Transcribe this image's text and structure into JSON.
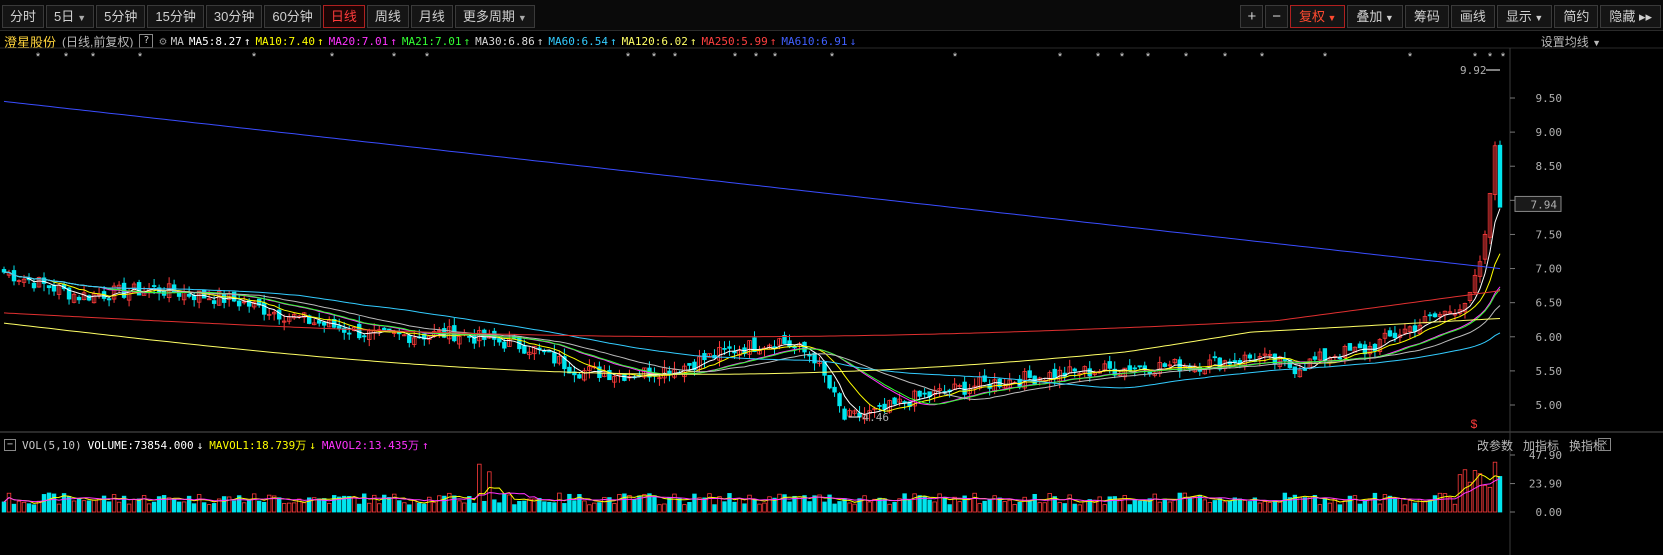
{
  "toolbar": {
    "tabs": [
      {
        "label": "分时",
        "dd": false,
        "active": false
      },
      {
        "label": "5日",
        "dd": true,
        "active": false
      },
      {
        "label": "5分钟",
        "dd": false,
        "active": false
      },
      {
        "label": "15分钟",
        "dd": false,
        "active": false
      },
      {
        "label": "30分钟",
        "dd": false,
        "active": false
      },
      {
        "label": "60分钟",
        "dd": false,
        "active": false
      },
      {
        "label": "日线",
        "dd": false,
        "active": true
      },
      {
        "label": "周线",
        "dd": false,
        "active": false
      },
      {
        "label": "月线",
        "dd": false,
        "active": false
      },
      {
        "label": "更多周期",
        "dd": true,
        "active": false
      }
    ],
    "right": [
      {
        "label": "+",
        "small": true
      },
      {
        "label": "−",
        "small": true
      },
      {
        "label": "复权",
        "dd": true,
        "active": true
      },
      {
        "label": "叠加",
        "dd": true
      },
      {
        "label": "筹码"
      },
      {
        "label": "画线"
      },
      {
        "label": "显示",
        "dd": true
      },
      {
        "label": "简约"
      },
      {
        "label": "隐藏 ▸▸"
      }
    ]
  },
  "legend": {
    "stock_name": "澄星股份",
    "mode": "(日线,前复权)",
    "help": "?",
    "ma_label": "MA",
    "items": [
      {
        "text": "MA5:8.27",
        "arrow": "↑",
        "color": "#ffffff"
      },
      {
        "text": "MA10:7.40",
        "arrow": "↑",
        "color": "#ffff00"
      },
      {
        "text": "MA20:7.01",
        "arrow": "↑",
        "color": "#ff33ff"
      },
      {
        "text": "MA21:7.01",
        "arrow": "↑",
        "color": "#33ff33"
      },
      {
        "text": "MA30:6.86",
        "arrow": "↑",
        "color": "#d8d8d8"
      },
      {
        "text": "MA60:6.54",
        "arrow": "↑",
        "color": "#33ccff"
      },
      {
        "text": "MA120:6.02",
        "arrow": "↑",
        "color": "#ffff66"
      },
      {
        "text": "MA250:5.99",
        "arrow": "↑",
        "color": "#ff4040"
      },
      {
        "text": "MA610:6.91",
        "arrow": "↓",
        "color": "#4060ff"
      }
    ],
    "set_ma": "设置均线"
  },
  "price_axis": {
    "labels": [
      "9.50",
      "9.00",
      "8.50",
      "8.00",
      "7.50",
      "7.00",
      "6.50",
      "6.00",
      "5.50",
      "5.00"
    ],
    "current": "7.94",
    "high_mark": "9.92",
    "low_mark": "4.46"
  },
  "vol": {
    "indicator": "VOL(5,10)",
    "volume": "VOLUME:73854.000",
    "volume_arrow": "↓",
    "mavol1": "MAVOL1:18.739万",
    "mavol1_arrow": "↓",
    "mavol2": "MAVOL2:13.435万",
    "mavol2_arrow": "↑",
    "axis": [
      "47.90",
      "23.90",
      "0.00"
    ],
    "buttons": [
      "改参数",
      "加指标",
      "换指标"
    ],
    "close": "×"
  },
  "colors": {
    "up": "#ff3b3b",
    "down": "#00e5ee",
    "ma610": "#3a4dff",
    "ma250": "#e03030"
  },
  "markers": {
    "star": "*",
    "sign": "$"
  }
}
